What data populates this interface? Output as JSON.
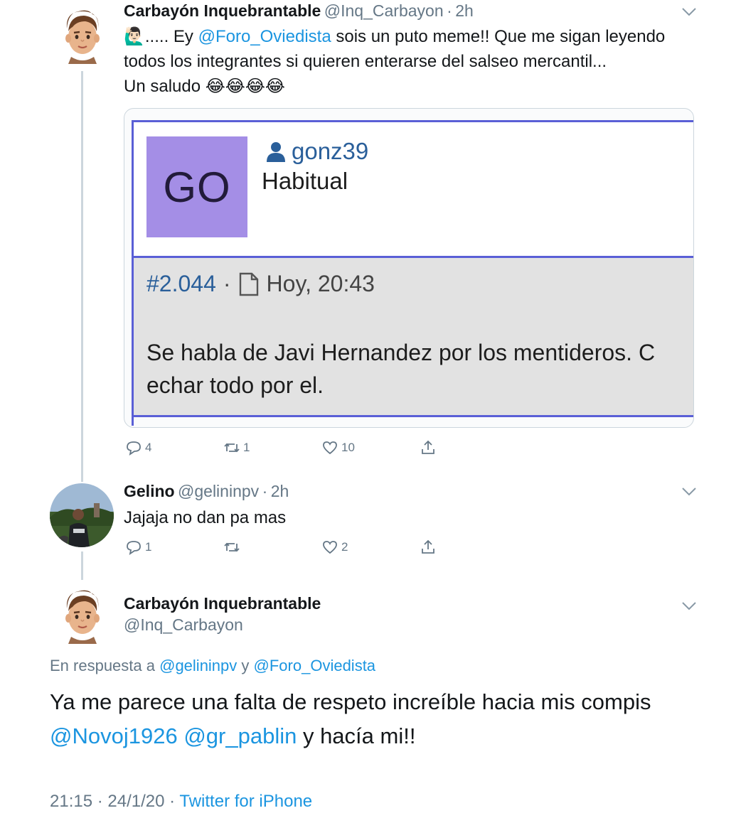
{
  "tweet1": {
    "name": "Carbayón Inquebrantable",
    "handle": "@Inq_Carbayon",
    "sep": "·",
    "time": "2h",
    "line1_pre": "..... Ey ",
    "line1_mention": "@Foro_Oviedista",
    "line1_post": " sois un puto meme!! Que me sigan leyendo",
    "line2": "todos los integrantes si quieren enterarse del salseo mercantil...",
    "line3": "Un saludo",
    "emoji_gesture": "🙋🏻‍♂️",
    "emoji_laugh": "😂😂😂😂",
    "media": {
      "avatar_initials": "GO",
      "username": "gonz39",
      "role": "Habitual",
      "post_number": "#2.044",
      "dot": "·",
      "post_time": "Hoy, 20:43",
      "body_line1": "Se habla de Javi Hernandez por los mentideros. C",
      "body_line2": "echar todo por el."
    },
    "replies": "4",
    "retweets": "1",
    "likes": "10"
  },
  "tweet2": {
    "name": "Gelino",
    "handle": "@gelininpv",
    "sep": "·",
    "time": "2h",
    "text": "Jajaja no dan pa mas",
    "replies": "1",
    "retweets": "",
    "likes": "2"
  },
  "tweet3": {
    "name": "Carbayón Inquebrantable",
    "handle": "@Inq_Carbayon",
    "reply_prefix": "En respuesta a ",
    "reply_to_1": "@gelininpv",
    "reply_and": " y ",
    "reply_to_2": "@Foro_Oviedista",
    "text_line1": "Ya me parece una falta de respeto increíble hacia mis compis",
    "mention_a": "@Novoj1926",
    "mention_b": "@gr_pablin",
    "text_end": " y hacía mi!!",
    "time": "21:15",
    "date": "24/1/20",
    "dot": "·",
    "source": "Twitter for iPhone"
  },
  "colors": {
    "link": "#1b95e0",
    "secondary": "#657786",
    "thread_line": "#ccd6dd"
  }
}
